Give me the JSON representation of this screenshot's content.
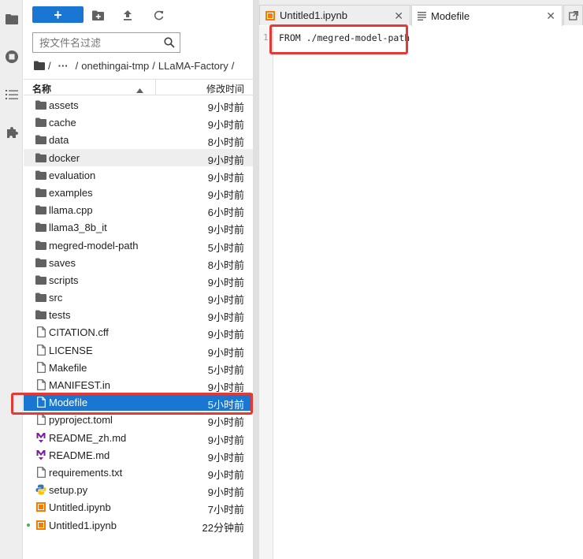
{
  "activity_bar": {
    "icons": [
      "folder-icon",
      "running-icon",
      "table-of-contents-icon",
      "extension-icon"
    ]
  },
  "file_browser": {
    "toolbar": {
      "new_label": "+",
      "icons": [
        "new-folder-icon",
        "upload-icon",
        "refresh-icon"
      ]
    },
    "filter": {
      "placeholder": "按文件名过滤",
      "value": ""
    },
    "breadcrumb": {
      "root_sep": "/",
      "ellipsis": "···",
      "parts": [
        "onethingai-tmp",
        "LLaMA-Factory"
      ],
      "sep": "/"
    },
    "columns": {
      "name": "名称",
      "modified": "修改时间"
    },
    "files": [
      {
        "name": "assets",
        "type": "folder",
        "modified": "9小时前"
      },
      {
        "name": "cache",
        "type": "folder",
        "modified": "9小时前"
      },
      {
        "name": "data",
        "type": "folder",
        "modified": "8小时前"
      },
      {
        "name": "docker",
        "type": "folder",
        "modified": "9小时前"
      },
      {
        "name": "evaluation",
        "type": "folder",
        "modified": "9小时前"
      },
      {
        "name": "examples",
        "type": "folder",
        "modified": "9小时前"
      },
      {
        "name": "llama.cpp",
        "type": "folder",
        "modified": "6小时前"
      },
      {
        "name": "llama3_8b_it",
        "type": "folder",
        "modified": "9小时前"
      },
      {
        "name": "megred-model-path",
        "type": "folder",
        "modified": "5小时前"
      },
      {
        "name": "saves",
        "type": "folder",
        "modified": "8小时前"
      },
      {
        "name": "scripts",
        "type": "folder",
        "modified": "9小时前"
      },
      {
        "name": "src",
        "type": "folder",
        "modified": "9小时前"
      },
      {
        "name": "tests",
        "type": "folder",
        "modified": "9小时前"
      },
      {
        "name": "CITATION.cff",
        "type": "file",
        "modified": "9小时前"
      },
      {
        "name": "LICENSE",
        "type": "file",
        "modified": "9小时前"
      },
      {
        "name": "Makefile",
        "type": "file",
        "modified": "5小时前"
      },
      {
        "name": "MANIFEST.in",
        "type": "file",
        "modified": "9小时前"
      },
      {
        "name": "Modefile",
        "type": "file",
        "modified": "5小时前"
      },
      {
        "name": "pyproject.toml",
        "type": "file",
        "modified": "9小时前"
      },
      {
        "name": "README_zh.md",
        "type": "markdown",
        "modified": "9小时前"
      },
      {
        "name": "README.md",
        "type": "markdown",
        "modified": "9小时前"
      },
      {
        "name": "requirements.txt",
        "type": "file",
        "modified": "9小时前"
      },
      {
        "name": "setup.py",
        "type": "python",
        "modified": "9小时前"
      },
      {
        "name": "Untitled.ipynb",
        "type": "notebook",
        "modified": "7小时前"
      },
      {
        "name": "Untitled1.ipynb",
        "type": "notebook",
        "modified": "22分钟前"
      }
    ]
  },
  "tabs": [
    {
      "label": "Untitled1.ipynb",
      "icon": "notebook-icon",
      "close": "✕"
    },
    {
      "label": "Modefile",
      "icon": "text-file-icon",
      "close": "✕"
    }
  ],
  "editor": {
    "line_number": "1",
    "line_text": "FROM ./megred-model-path"
  },
  "colors": {
    "accent": "#1976d2",
    "highlight_box": "#e53935",
    "folder": "#616161",
    "notebook": "#f57c00",
    "markdown": "#7b1fa2"
  }
}
